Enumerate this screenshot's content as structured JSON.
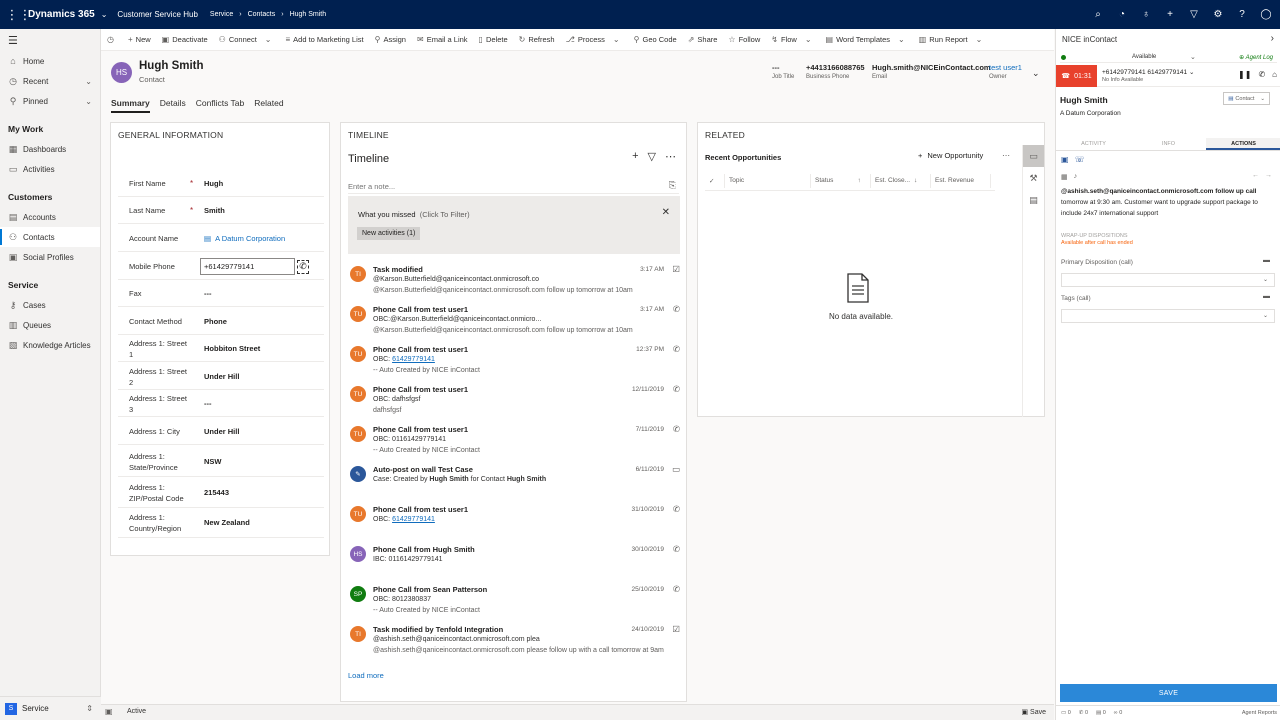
{
  "topbar": {
    "app_name": "Dynamics 365",
    "hub": "Customer Service Hub",
    "breadcrumbs": [
      "Service",
      "Contacts",
      "Hugh Smith"
    ],
    "icons": [
      "search-icon",
      "task-icon",
      "lightbulb-icon",
      "plus-icon",
      "filter-icon",
      "gear-icon",
      "help-icon",
      "user-icon"
    ]
  },
  "sidebar": {
    "top_items": [
      {
        "label": "Home",
        "icon": "home-icon"
      },
      {
        "label": "Recent",
        "icon": "clock-icon"
      },
      {
        "label": "Pinned",
        "icon": "pin-icon"
      }
    ],
    "mywork_heading": "My Work",
    "mywork_items": [
      {
        "label": "Dashboards",
        "icon": "dashboard-icon"
      },
      {
        "label": "Activities",
        "icon": "activities-icon"
      }
    ],
    "customers_heading": "Customers",
    "customers_items": [
      {
        "label": "Accounts",
        "icon": "accounts-icon"
      },
      {
        "label": "Contacts",
        "icon": "contacts-icon"
      },
      {
        "label": "Social Profiles",
        "icon": "social-icon"
      }
    ],
    "service_heading": "Service",
    "service_items": [
      {
        "label": "Cases",
        "icon": "cases-icon"
      },
      {
        "label": "Queues",
        "icon": "queues-icon"
      },
      {
        "label": "Knowledge Articles",
        "icon": "knowledge-icon"
      }
    ],
    "area": {
      "badge": "S",
      "label": "Service"
    }
  },
  "commands": {
    "new": "New",
    "deactivate": "Deactivate",
    "connect": "Connect",
    "add_marketing": "Add to Marketing List",
    "assign": "Assign",
    "email_link": "Email a Link",
    "delete": "Delete",
    "refresh": "Refresh",
    "process": "Process",
    "geo_code": "Geo Code",
    "share": "Share",
    "follow": "Follow",
    "flow": "Flow",
    "word_templates": "Word Templates",
    "run_report": "Run Report"
  },
  "record": {
    "initials": "HS",
    "name": "Hugh Smith",
    "type": "Contact",
    "job_title": "---",
    "job_title_label": "Job Title",
    "business_phone": "+4413166088765",
    "business_phone_label": "Business Phone",
    "email": "Hugh.smith@NICEinContact.com",
    "email_label": "Email",
    "owner": "test user1",
    "owner_label": "Owner"
  },
  "tabs": [
    "Summary",
    "Details",
    "Conflicts Tab",
    "Related"
  ],
  "general": {
    "title": "GENERAL INFORMATION",
    "first_name_label": "First Name",
    "first_name": "Hugh",
    "last_name_label": "Last Name",
    "last_name": "Smith",
    "account_label": "Account Name",
    "account": "A Datum Corporation",
    "mobile_label": "Mobile Phone",
    "mobile": "+61429779141",
    "fax_label": "Fax",
    "fax": "---",
    "contact_method_label": "Contact Method",
    "contact_method": "Phone",
    "street1_label": "Address 1: Street 1",
    "street1": "Hobbiton Street",
    "street2_label": "Address 1: Street 2",
    "street2": "Under Hill",
    "street3_label": "Address 1: Street 3",
    "street3": "---",
    "city_label": "Address 1: City",
    "city": "Under Hill",
    "state_label": "Address 1: State/Province",
    "state": "NSW",
    "zip_label": "Address 1: ZIP/Postal Code",
    "zip": "215443",
    "country_label": "Address 1: Country/Region",
    "country": "New Zealand"
  },
  "timeline": {
    "section": "TIMELINE",
    "heading": "Timeline",
    "note_placeholder": "Enter a note...",
    "missed": "What you missed",
    "missed_hint": "(Click To Filter)",
    "new_activities": "New activities (1)",
    "load_more": "Load more",
    "items": [
      {
        "initials": "TI",
        "color": "#e8782c",
        "title": "Task modified",
        "line1": "@Karson.Butterfield@qaniceincontact.onmicrosoft.co",
        "line2": "@Karson.Butterfield@qaniceincontact.onmicrosoft.com follow up tomorrow at 10am",
        "date": "3:17 AM",
        "icon": "task-check-icon"
      },
      {
        "initials": "TU",
        "color": "#e8782c",
        "title": "Phone Call from test user1",
        "line1": "OBC:@Karson.Butterfield@qaniceincontact.onmicro...",
        "line2": "@Karson.Butterfield@qaniceincontact.onmicrosoft.com follow up tomorrow at 10am",
        "date": "3:17 AM",
        "icon": "phone-icon"
      },
      {
        "initials": "TU",
        "color": "#e8782c",
        "title": "Phone Call from test user1",
        "line1_prefix": "OBC: ",
        "line1_link": "61429779141",
        "line2": "-- Auto Created by NICE inContact",
        "date": "12:37 PM",
        "icon": "phone-icon"
      },
      {
        "initials": "TU",
        "color": "#e8782c",
        "title": "Phone Call from test user1",
        "line1": "OBC: dafhsfgsf",
        "line2": "dafhsfgsf",
        "date": "12/11/2019",
        "icon": "phone-icon"
      },
      {
        "initials": "TU",
        "color": "#e8782c",
        "title": "Phone Call from test user1",
        "line1": "OBC: 01161429779141",
        "line2": "-- Auto Created by NICE inContact",
        "date": "7/11/2019",
        "icon": "phone-icon"
      },
      {
        "initials": "",
        "color": "#2b579a",
        "title": "Auto-post on wall Test Case",
        "line1_case": "Case: Created by ",
        "line1_b1": "Hugh Smith",
        "line1_mid": " for Contact ",
        "line1_b2": "Hugh Smith",
        "date": "6/11/2019",
        "icon": "post-icon"
      },
      {
        "initials": "TU",
        "color": "#e8782c",
        "title": "Phone Call from test user1",
        "line1_prefix": "OBC: ",
        "line1_link": "61429779141",
        "date": "31/10/2019",
        "icon": "phone-icon"
      },
      {
        "initials": "HS",
        "color": "#8764b8",
        "title": "Phone Call from Hugh Smith",
        "line1": "IBC: 01161429779141",
        "date": "30/10/2019",
        "icon": "phone-icon"
      },
      {
        "initials": "SP",
        "color": "#107c10",
        "title": "Phone Call from Sean Patterson",
        "line1": "OBC: 8012380837",
        "line2": "-- Auto Created by NICE inContact",
        "date": "25/10/2019",
        "icon": "phone-icon"
      },
      {
        "initials": "TI",
        "color": "#e8782c",
        "title": "Task modified by Tenfold Integration",
        "line1": "@ashish.seth@qaniceincontact.onmicrosoft.com  plea",
        "line2": "@ashish.seth@qaniceincontact.onmicrosoft.com  please follow up with a call tomorrow at 9am",
        "date": "24/10/2019",
        "icon": "task-check-icon"
      }
    ]
  },
  "related": {
    "title": "RELATED",
    "subgrid_title": "Recent Opportunities",
    "new_label": "New Opportunity",
    "columns": [
      "Topic",
      "Status",
      "Est. Close...",
      "Est. Revenue"
    ],
    "no_data": "No data available."
  },
  "panel": {
    "title": "NICE inContact",
    "availability": "Available",
    "agent_log": "Agent Log",
    "timer": "01:31",
    "call_number": "+61429779141 61429779141",
    "call_info": "No Info Available",
    "contact_name": "Hugh Smith",
    "contact_account": "A Datum Corporation",
    "contact_button": "Contact",
    "tabs": [
      "ACTIVITY",
      "INFO",
      "ACTIONS"
    ],
    "note_bold": "@ashish.seth@qaniceincontact.onmicrosoft.com follow up call",
    "note_rest": "tomorrow at 9:30 am. Customer want to upgrade support package to include 24x7 international support",
    "wrap_title": "WRAP-UP DISPOSITIONS",
    "wrap_sub": "Available after call has ended",
    "primary_label": "Primary Disposition (call)",
    "tags_label": "Tags (call)",
    "save": "SAVE",
    "footer_counts": [
      "0",
      "0",
      "0",
      "0"
    ],
    "agent_reports": "Agent Reports"
  },
  "statusbar": {
    "status": "Active",
    "save": "Save"
  }
}
